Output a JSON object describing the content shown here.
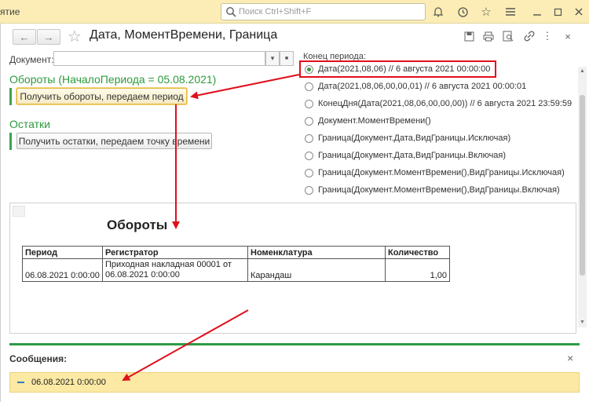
{
  "topbar": {
    "app_title": "ятие",
    "search_placeholder": "Поиск Ctrl+Shift+F",
    "icons": [
      "bell-icon",
      "history-icon",
      "star-icon",
      "menu-icon"
    ]
  },
  "window": {
    "title": "Дата, МоментВремени, Граница",
    "header_icons": [
      "save-icon",
      "print-icon",
      "preview-icon",
      "link-icon",
      "more-icon",
      "close-icon"
    ]
  },
  "form": {
    "document_label": "Документ:",
    "document_value": "",
    "turnover_header": "Обороты (НачалоПериода = 05.08.2021)",
    "turnover_button": "Получить обороты, передаем период",
    "balance_header": "Остатки",
    "balance_button": "Получить остатки, передаем точку времени"
  },
  "period": {
    "label": "Конец периода:",
    "options": [
      {
        "label": "Дата(2021,08,06) // 6 августа 2021 00:00:00",
        "selected": true
      },
      {
        "label": "Дата(2021,08,06,00,00,01) // 6 августа 2021 00:00:01",
        "selected": false
      },
      {
        "label": "КонецДня(Дата(2021,08,06,00,00,00)) // 6 августа 2021 23:59:59",
        "selected": false
      },
      {
        "label": "Документ.МоментВремени()",
        "selected": false
      },
      {
        "label": "Граница(Документ.Дата,ВидГраницы.Исключая)",
        "selected": false
      },
      {
        "label": "Граница(Документ.Дата,ВидГраницы.Включая)",
        "selected": false
      },
      {
        "label": "Граница(Документ.МоментВремени(),ВидГраницы.Исключая)",
        "selected": false
      },
      {
        "label": "Граница(Документ.МоментВремени(),ВидГраницы.Включая)",
        "selected": false
      }
    ]
  },
  "report": {
    "title": "Обороты",
    "columns": [
      "Период",
      "Регистратор",
      "Номенклатура",
      "Количество"
    ],
    "rows": [
      {
        "period": "06.08.2021 0:00:00",
        "registrar_line1": "Приходная накладная 00001 от",
        "registrar_line2": "06.08.2021 0:00:00",
        "item": "Карандаш",
        "qty": "1,00"
      }
    ]
  },
  "messages": {
    "title": "Сообщения:",
    "close": "×",
    "items": [
      "06.08.2021 0:00:00"
    ]
  },
  "colors": {
    "accent_green": "#2d9b3c",
    "topbar_bg": "#fbedb5",
    "message_bg": "#fbe9a4",
    "annotation_red": "#e0101a"
  }
}
